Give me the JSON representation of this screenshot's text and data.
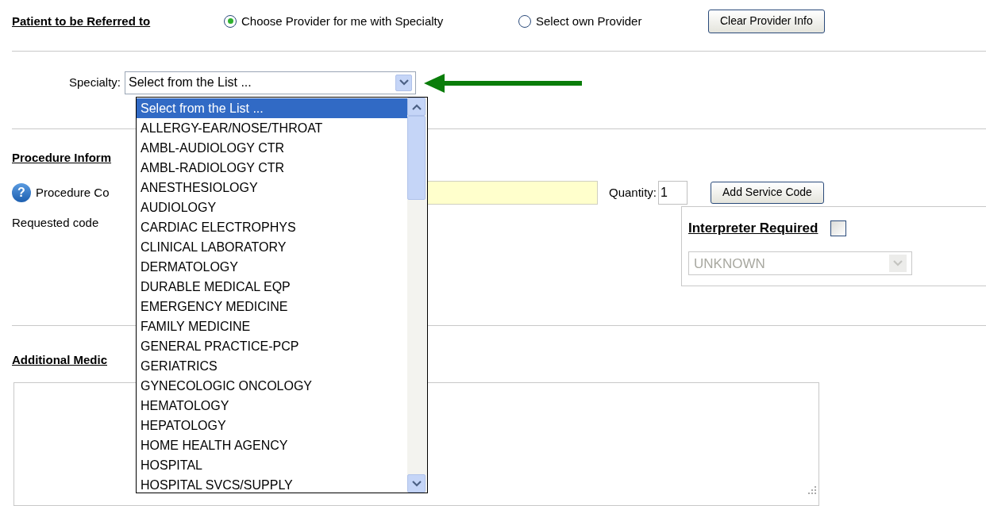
{
  "referral": {
    "heading": "Patient to be Referred to",
    "options": [
      {
        "label": "Choose Provider for me with Specialty",
        "selected": true
      },
      {
        "label": "Select own Provider",
        "selected": false
      }
    ],
    "button": "Clear Provider Info"
  },
  "specialty": {
    "label": "Specialty:",
    "value": "Select from the List ...",
    "expanded": true,
    "options": [
      {
        "label": "Select from the List ...",
        "selected": true
      },
      {
        "label": "ALLERGY-EAR/NOSE/THROAT",
        "selected": false
      },
      {
        "label": "AMBL-AUDIOLOGY CTR",
        "selected": false
      },
      {
        "label": "AMBL-RADIOLOGY CTR",
        "selected": false
      },
      {
        "label": "ANESTHESIOLOGY",
        "selected": false
      },
      {
        "label": "AUDIOLOGY",
        "selected": false
      },
      {
        "label": "CARDIAC ELECTROPHYS",
        "selected": false
      },
      {
        "label": "CLINICAL LABORATORY",
        "selected": false
      },
      {
        "label": "DERMATOLOGY",
        "selected": false
      },
      {
        "label": "DURABLE MEDICAL EQP",
        "selected": false
      },
      {
        "label": "EMERGENCY MEDICINE",
        "selected": false
      },
      {
        "label": "FAMILY MEDICINE",
        "selected": false
      },
      {
        "label": "GENERAL PRACTICE-PCP",
        "selected": false
      },
      {
        "label": "GERIATRICS",
        "selected": false
      },
      {
        "label": "GYNECOLOGIC ONCOLOGY",
        "selected": false
      },
      {
        "label": "HEMATOLOGY",
        "selected": false
      },
      {
        "label": "HEPATOLOGY",
        "selected": false
      },
      {
        "label": "HOME HEALTH AGENCY",
        "selected": false
      },
      {
        "label": "HOSPITAL",
        "selected": false
      },
      {
        "label": "HOSPITAL SVCS/SUPPLY",
        "selected": false
      }
    ]
  },
  "procedure": {
    "heading": "Procedure Inform",
    "help_icon": "?",
    "code_label": "Procedure Co",
    "quantity_label": "Quantity:",
    "quantity": "1",
    "button": "Add Service Code",
    "requested_label": "Requested code"
  },
  "interpreter": {
    "heading": "Interpreter Required",
    "checked": false,
    "language": "UNKNOWN",
    "disabled": true
  },
  "additional": {
    "heading": "Additional Medic"
  }
}
